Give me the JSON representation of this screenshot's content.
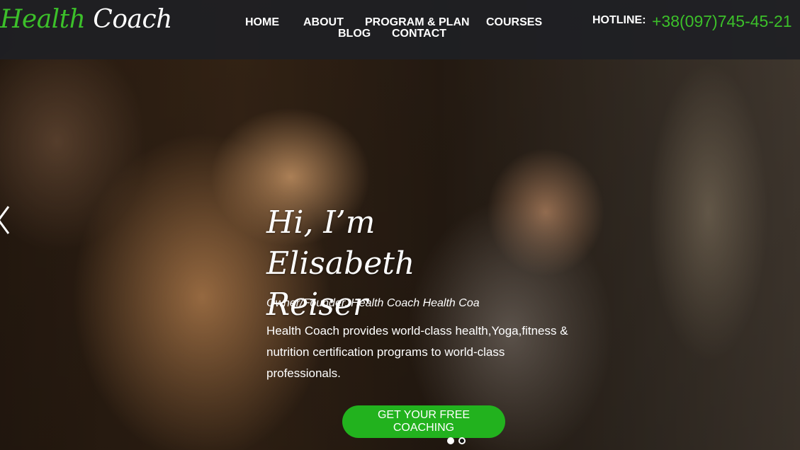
{
  "brand": {
    "part1": "Health",
    "part2": "Coach"
  },
  "nav": {
    "home": "HOME",
    "about": "ABOUT",
    "program": "PROGRAM & PLAN",
    "courses": "COURSES",
    "blog": "BLOG",
    "contact": "CONTACT"
  },
  "hotline": {
    "label": "HOTLINE:",
    "number": "+38(097)745-45-21"
  },
  "hero": {
    "headline": "Hi, I’m Elisabeth Reiser",
    "role": "Owner/Founder, Health Coach Health Coa",
    "description": "Health Coach provides world-class health,Yoga,fitness & nutrition certification programs to world-class professionals.",
    "cta": "GET YOUR FREE COACHING"
  },
  "slider": {
    "current": 1,
    "total": 2
  },
  "colors": {
    "accent": "#3cc02a",
    "button": "#22b21e",
    "header_bg": "#1e2024"
  },
  "icons": {
    "prev": "chevron-left-icon"
  }
}
